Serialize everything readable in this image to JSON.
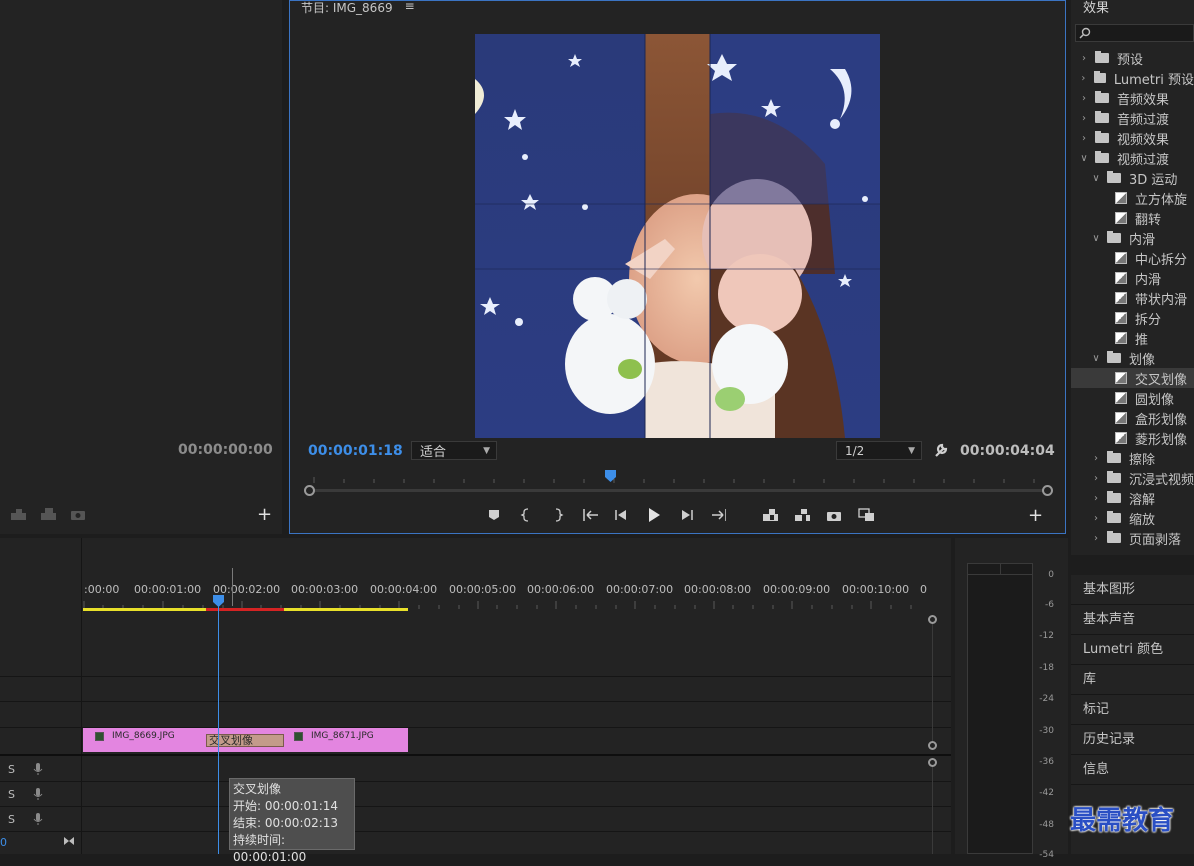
{
  "left_monitor": {
    "timecode": "00:00:00:00"
  },
  "program_monitor": {
    "title": "节目: IMG_8669",
    "menu_glyph": "≡",
    "current_time": "00:00:01:18",
    "fit_label": "适合",
    "resolution": "1/2",
    "duration": "00:00:04:04"
  },
  "effects": {
    "title": "效果",
    "search_placeholder": "",
    "tree": [
      {
        "label": "预设",
        "level": 0,
        "type": "folder",
        "open": false
      },
      {
        "label": "Lumetri 预设",
        "level": 0,
        "type": "folder",
        "open": false
      },
      {
        "label": "音频效果",
        "level": 0,
        "type": "folder",
        "open": false
      },
      {
        "label": "音频过渡",
        "level": 0,
        "type": "folder",
        "open": false
      },
      {
        "label": "视频效果",
        "level": 0,
        "type": "folder",
        "open": false
      },
      {
        "label": "视频过渡",
        "level": 0,
        "type": "folder",
        "open": true
      },
      {
        "label": "3D 运动",
        "level": 1,
        "type": "folder",
        "open": true
      },
      {
        "label": "立方体旋",
        "level": 2,
        "type": "fx"
      },
      {
        "label": "翻转",
        "level": 2,
        "type": "fx"
      },
      {
        "label": "内滑",
        "level": 1,
        "type": "folder",
        "open": true
      },
      {
        "label": "中心拆分",
        "level": 2,
        "type": "fx"
      },
      {
        "label": "内滑",
        "level": 2,
        "type": "fx"
      },
      {
        "label": "带状内滑",
        "level": 2,
        "type": "fx"
      },
      {
        "label": "拆分",
        "level": 2,
        "type": "fx"
      },
      {
        "label": "推",
        "level": 2,
        "type": "fx"
      },
      {
        "label": "划像",
        "level": 1,
        "type": "folder",
        "open": true
      },
      {
        "label": "交叉划像",
        "level": 2,
        "type": "fx",
        "selected": true
      },
      {
        "label": "圆划像",
        "level": 2,
        "type": "fx"
      },
      {
        "label": "盒形划像",
        "level": 2,
        "type": "fx"
      },
      {
        "label": "菱形划像",
        "level": 2,
        "type": "fx"
      },
      {
        "label": "擦除",
        "level": 1,
        "type": "folder",
        "open": false
      },
      {
        "label": "沉浸式视频",
        "level": 1,
        "type": "folder",
        "open": false
      },
      {
        "label": "溶解",
        "level": 1,
        "type": "folder",
        "open": false
      },
      {
        "label": "缩放",
        "level": 1,
        "type": "folder",
        "open": false
      },
      {
        "label": "页面剥落",
        "level": 1,
        "type": "folder",
        "open": false
      }
    ]
  },
  "side_panels": [
    "基本图形",
    "基本声音",
    "Lumetri 颜色",
    "库",
    "标记",
    "历史记录",
    "信息"
  ],
  "timeline": {
    "ruler_labels": [
      ":00:00",
      "00:00:01:00",
      "00:00:02:00",
      "00:00:03:00",
      "00:00:04:00",
      "00:00:05:00",
      "00:00:06:00",
      "00:00:07:00",
      "00:00:08:00",
      "00:00:09:00",
      "00:00:10:00",
      "0"
    ],
    "clip1": "IMG_8669.JPG",
    "clip2": "IMG_8671.JPG",
    "transition": "交叉划像",
    "audio_s": [
      "S",
      "S",
      "S"
    ],
    "left_zero": "0",
    "tooltip": {
      "title": "交叉划像",
      "start": "开始: 00:00:01:14",
      "end": "结束: 00:00:02:13",
      "duration": "持续时间: 00:00:01:00"
    }
  },
  "meters": {
    "db": [
      "0",
      "-6",
      "-12",
      "-18",
      "-24",
      "-30",
      "-36",
      "-42",
      "-48",
      "-54"
    ]
  },
  "watermark": "最需教育",
  "colors": {
    "accent": "#3d8ee8",
    "clip": "#e385e0",
    "transition": "#c39b8a",
    "work_area": "#e8e02a",
    "render_red": "#d42323"
  }
}
